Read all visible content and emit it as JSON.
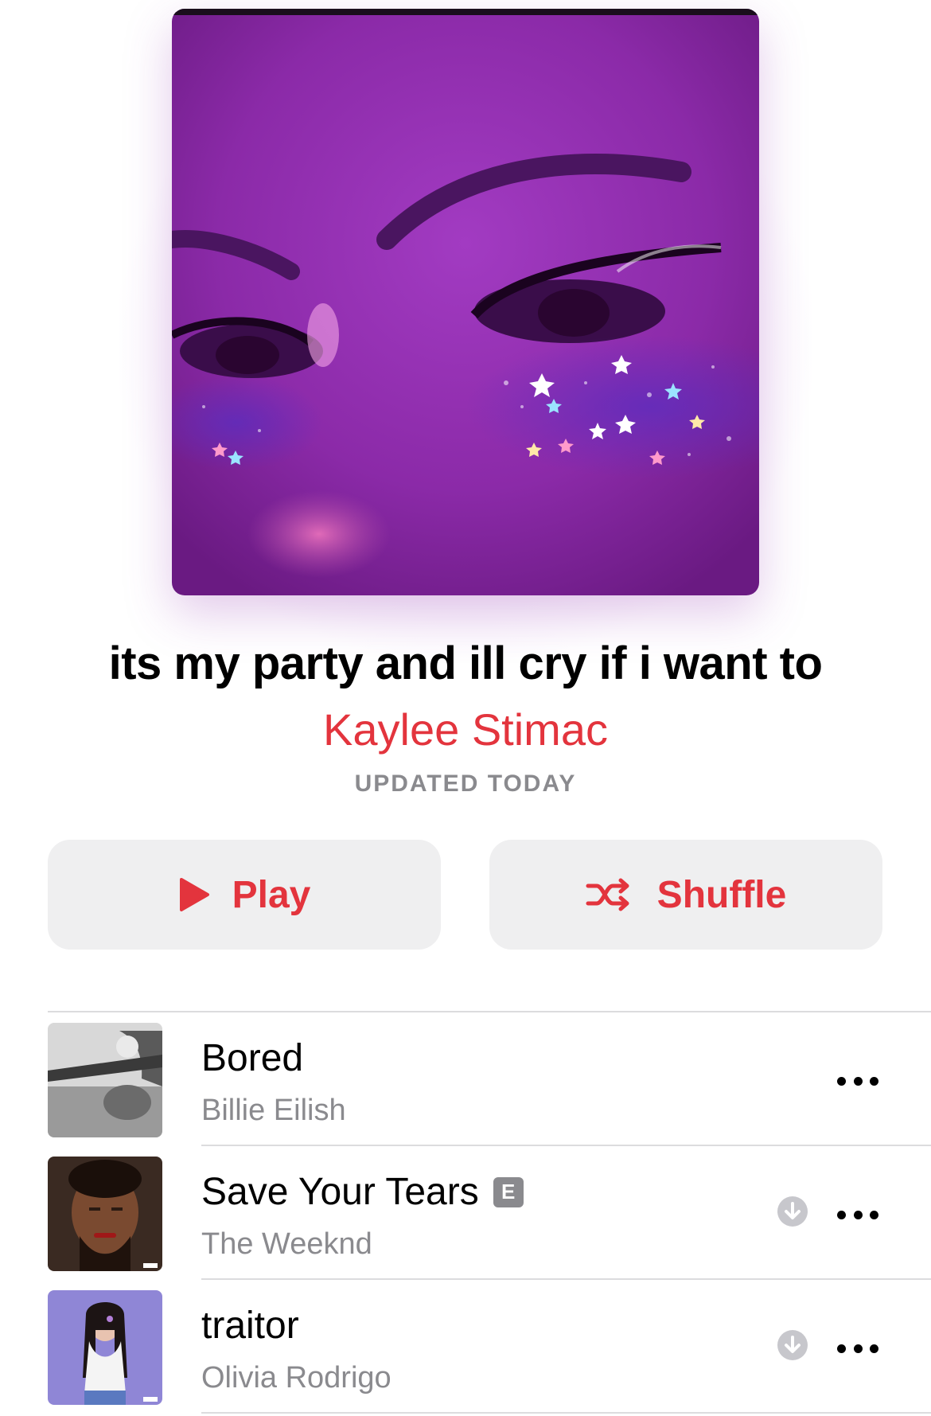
{
  "playlist": {
    "title": "its my party and ill cry if i want to",
    "curator": "Kaylee Stimac",
    "updated": "UPDATED TODAY",
    "artwork_icon": "playlist-artwork"
  },
  "actions": {
    "play_label": "Play",
    "shuffle_label": "Shuffle",
    "play_icon": "play-icon",
    "shuffle_icon": "shuffle-icon"
  },
  "colors": {
    "accent": "#e3343d",
    "secondary_text": "#8a8a8e",
    "button_background": "#efeff0",
    "divider": "#dcdcde"
  },
  "tracks": [
    {
      "title": "Bored",
      "artist": "Billie Eilish",
      "explicit": false,
      "downloaded_icon": false,
      "more_icon": "more-icon"
    },
    {
      "title": "Save Your Tears",
      "artist": "The Weeknd",
      "explicit": true,
      "explicit_badge": "E",
      "downloaded_icon": true,
      "more_icon": "more-icon"
    },
    {
      "title": "traitor",
      "artist": "Olivia Rodrigo",
      "explicit": false,
      "downloaded_icon": true,
      "more_icon": "more-icon"
    }
  ]
}
